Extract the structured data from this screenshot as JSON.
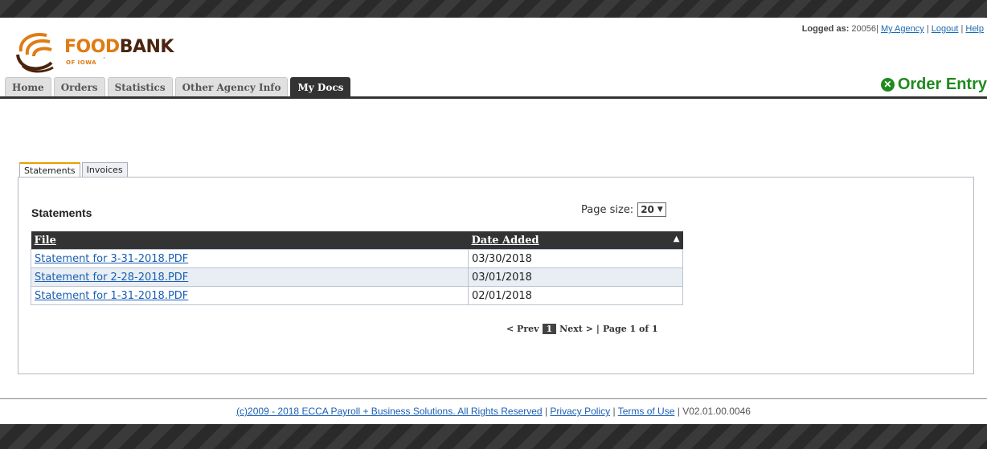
{
  "brand": {
    "logo_primary": "FOOD",
    "logo_secondary": "BANK",
    "logo_sub": "OF IOWA",
    "logo_dot": "·",
    "accent_orange": "#e07b13",
    "accent_brown": "#4b2410"
  },
  "login": {
    "label": "Logged as:",
    "user": "20056|",
    "my_agency": "My Agency",
    "sep1": "|",
    "logout": "Logout",
    "sep2": "|",
    "help": "Help"
  },
  "nav": {
    "tabs": [
      {
        "label": "Home"
      },
      {
        "label": "Orders"
      },
      {
        "label": "Statistics"
      },
      {
        "label": "Other Agency Info"
      },
      {
        "label": "My Docs",
        "active": true
      }
    ]
  },
  "order_entry": {
    "icon": "close-circle-icon",
    "icon_glyph": "✕",
    "label": "Order Entry",
    "color": "#1f8a1f"
  },
  "doc_tabs": [
    {
      "label": "Statements",
      "active": true
    },
    {
      "label": "Invoices"
    }
  ],
  "panel": {
    "title": "Statements",
    "page_size_label": "Page size:",
    "page_size_value": "20",
    "page_size_arrow": "▼"
  },
  "grid": {
    "columns": [
      "File",
      "Date Added"
    ],
    "sort_indicator": "▲",
    "rows": [
      {
        "file": "Statement for 3-31-2018.PDF",
        "date": "03/30/2018"
      },
      {
        "file": "Statement for 2-28-2018.PDF",
        "date": "03/01/2018"
      },
      {
        "file": "Statement for 1-31-2018.PDF",
        "date": "02/01/2018"
      }
    ]
  },
  "pager": {
    "prev": "< Prev",
    "current": "1",
    "next": "Next >",
    "sep": "|",
    "page_info": "Page 1 of 1"
  },
  "footer": {
    "copyright": "(c)2009 - 2018 ECCA Payroll + Business Solutions. All Rights Reserved",
    "sep1": "|",
    "privacy": "Privacy Policy",
    "sep2": "|",
    "terms": "Terms of Use",
    "sep3": "|",
    "version": "V02.01.00.0046"
  }
}
